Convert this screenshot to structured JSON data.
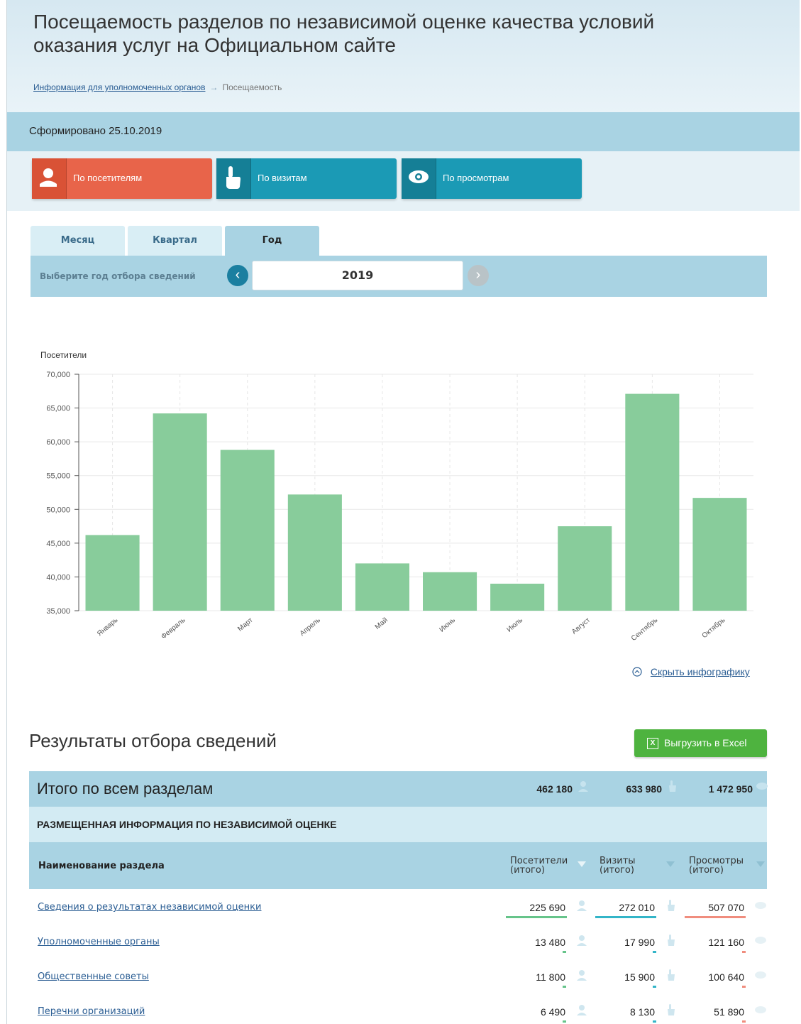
{
  "page": {
    "title": "Посещаемость разделов по независимой оценке качества условий оказания услуг на Официальном сайте",
    "breadcrumb_link": "Информация для уполномоченных органов",
    "breadcrumb_current": "Посещаемость",
    "generated": "Сформировано 25.10.2019"
  },
  "modes": {
    "visitors": "По посетителям",
    "visits": "По визитам",
    "views": "По просмотрам"
  },
  "tabs": [
    "Месяц",
    "Квартал",
    "Год"
  ],
  "filter": {
    "label": "Выберите год отбора сведений",
    "year": "2019"
  },
  "colors": {
    "bar": "#88cc9b",
    "accent_blue": "#1b9ab5",
    "accent_red": "#e8644a",
    "accent_green": "#4eb33f",
    "band": "#a9d3e3"
  },
  "chart_data": {
    "type": "bar",
    "ylabel": "Посетители",
    "ylim": [
      35000,
      70000
    ],
    "yticks": [
      "35,000",
      "40,000",
      "45,000",
      "50,000",
      "55,000",
      "60,000",
      "65,000",
      "70,000"
    ],
    "ytick_values": [
      35000,
      40000,
      45000,
      50000,
      55000,
      60000,
      65000,
      70000
    ],
    "categories": [
      "Январь",
      "Февраль",
      "Март",
      "Апрель",
      "Май",
      "Июнь",
      "Июль",
      "Август",
      "Сентябрь",
      "Октябрь"
    ],
    "values": [
      46200,
      64200,
      58800,
      52200,
      42000,
      40700,
      39000,
      47500,
      67100,
      51700
    ],
    "grid": true
  },
  "chart_toggle": "Скрыть инфографику",
  "results": {
    "title": "Результаты отбора сведений",
    "export_label": "Выгрузить в Excel",
    "total_label": "Итого по всем разделам",
    "total_visitors": "462 180",
    "total_visits": "633 980",
    "total_views": "1 472 950",
    "section_title": "РАЗМЕЩЕННАЯ ИНФОРМАЦИЯ ПО НЕЗАВИСИМОЙ ОЦЕНКЕ",
    "col_name": "Наименование раздела",
    "col_visitors": [
      "Посетители",
      "(итого)"
    ],
    "col_visits": [
      "Визиты",
      "(итого)"
    ],
    "col_views": [
      "Просмотры",
      "(итого)"
    ],
    "rows": [
      {
        "name": "Сведения о результатах независимой оценки",
        "visitors": "225 690",
        "visits": "272 010",
        "views": "507 070"
      },
      {
        "name": "Уполномоченные органы",
        "visitors": "13 480",
        "visits": "17 990",
        "views": "121 160"
      },
      {
        "name": "Общественные советы",
        "visitors": "11 800",
        "visits": "15 900",
        "views": "100 640"
      },
      {
        "name": "Перечни организаций",
        "visitors": "6 490",
        "visits": "8 130",
        "views": "51 890"
      }
    ]
  },
  "icons": {
    "visitors": "person-icon",
    "visits": "hand-pointer-icon",
    "views": "eye-icon",
    "prev": "chevron-left-icon",
    "next": "chevron-right-icon",
    "collapse": "chevron-up-circle-icon",
    "excel": "excel-icon",
    "sort": "sort-down-icon"
  }
}
